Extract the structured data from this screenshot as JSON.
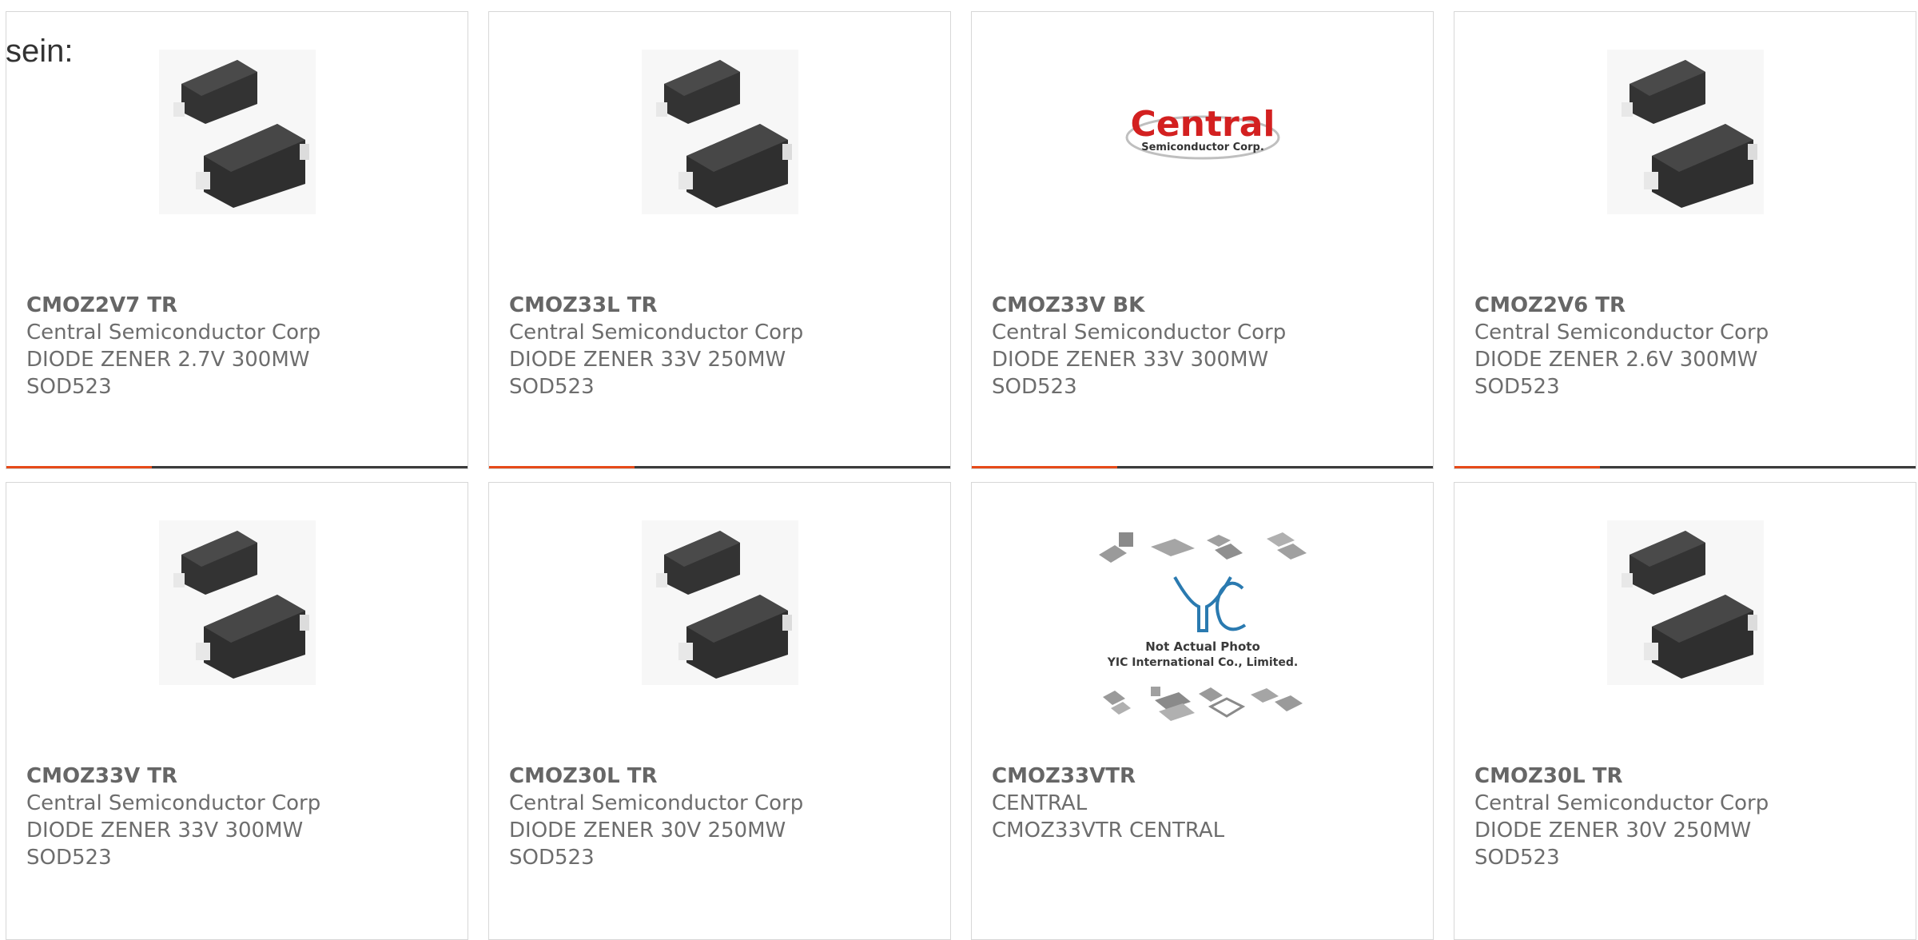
{
  "intro_text": "sein:",
  "products": [
    {
      "part": "CMOZ2V7 TR",
      "maker": "Central Semiconductor Corp",
      "desc": "DIODE ZENER 2.7V 300MW",
      "pkg": "SOD523",
      "image": "sod523-diode-image"
    },
    {
      "part": "CMOZ33L TR",
      "maker": "Central Semiconductor Corp",
      "desc": "DIODE ZENER 33V 250MW",
      "pkg": "SOD523",
      "image": "sod523-diode-image"
    },
    {
      "part": "CMOZ33V BK",
      "maker": "Central Semiconductor Corp",
      "desc": "DIODE ZENER 33V 300MW",
      "pkg": "SOD523",
      "image": "central-logo"
    },
    {
      "part": "CMOZ2V6 TR",
      "maker": "Central Semiconductor Corp",
      "desc": "DIODE ZENER 2.6V 300MW",
      "pkg": "SOD523",
      "image": "sod523-diode-image"
    },
    {
      "part": "CMOZ33V TR",
      "maker": "Central Semiconductor Corp",
      "desc": "DIODE ZENER 33V 300MW",
      "pkg": "SOD523",
      "image": "sod523-diode-image"
    },
    {
      "part": "CMOZ30L TR",
      "maker": "Central Semiconductor Corp",
      "desc": "DIODE ZENER 30V 250MW",
      "pkg": "SOD523",
      "image": "sod523-diode-image"
    },
    {
      "part": "CMOZ33VTR",
      "maker": "CENTRAL",
      "desc": "CMOZ33VTR CENTRAL",
      "pkg": "",
      "image": "yic-placeholder-image"
    },
    {
      "part": "CMOZ30L TR",
      "maker": "Central Semiconductor Corp",
      "desc": "DIODE ZENER 30V 250MW",
      "pkg": "SOD523",
      "image": "sod523-diode-image"
    }
  ],
  "logo_central": {
    "brand": "Central",
    "tagline": "Semiconductor Corp."
  },
  "yic_placeholder": {
    "brand": "YIC",
    "line1": "Not Actual Photo",
    "line2": "YIC International Co., Limited."
  },
  "colors": {
    "accent": "#e64a19",
    "bar": "#3c3c3c",
    "text": "#666666"
  }
}
